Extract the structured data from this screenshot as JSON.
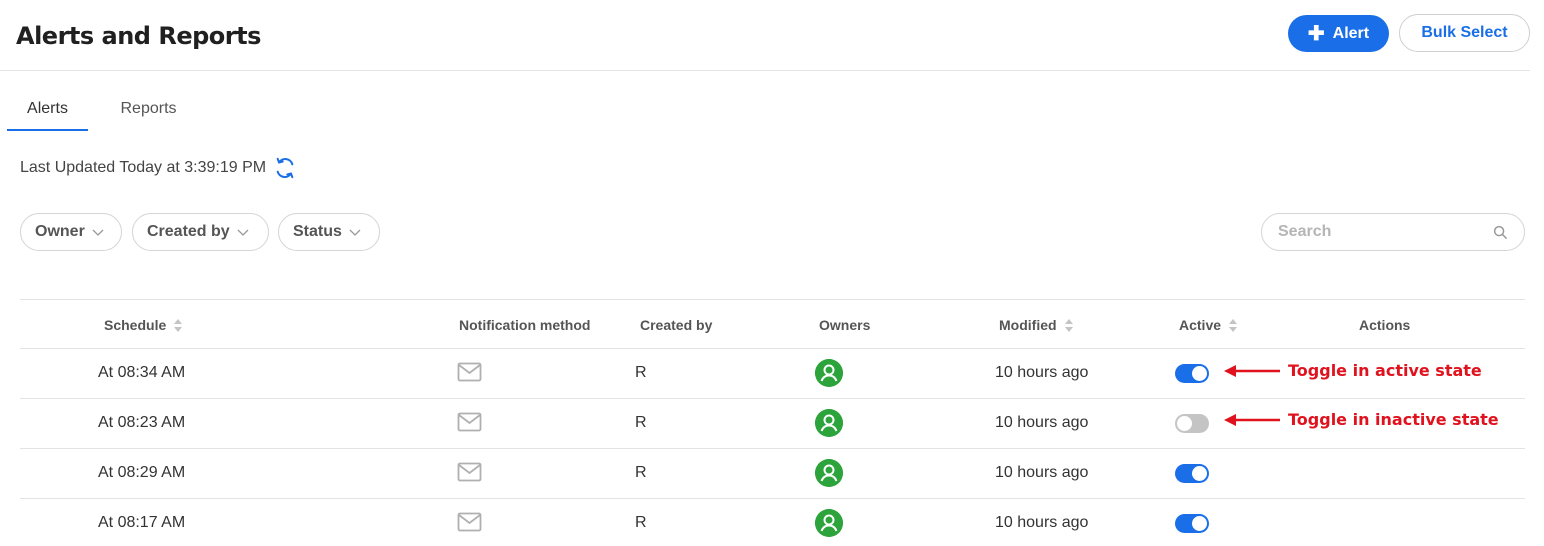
{
  "header": {
    "title": "Alerts and Reports",
    "add_alert_label": "Alert",
    "bulk_select_label": "Bulk Select"
  },
  "tabs": [
    {
      "label": "Alerts",
      "active": true
    },
    {
      "label": "Reports",
      "active": false
    }
  ],
  "last_updated": "Last Updated Today at 3:39:19 PM",
  "filters": [
    {
      "label": "Owner"
    },
    {
      "label": "Created by"
    },
    {
      "label": "Status"
    }
  ],
  "search": {
    "placeholder": "Search",
    "value": ""
  },
  "table": {
    "columns": [
      "Schedule",
      "Notification method",
      "Created by",
      "Owners",
      "Modified",
      "Active",
      "Actions"
    ],
    "rows": [
      {
        "schedule": "At 08:34 AM",
        "notification": "mail-icon",
        "created_by": "R",
        "owner": "user-avatar",
        "modified": "10 hours ago",
        "active": true
      },
      {
        "schedule": "At 08:23 AM",
        "notification": "mail-icon",
        "created_by": "R",
        "owner": "user-avatar",
        "modified": "10 hours ago",
        "active": false
      },
      {
        "schedule": "At 08:29 AM",
        "notification": "mail-icon",
        "created_by": "R",
        "owner": "user-avatar",
        "modified": "10 hours ago",
        "active": true
      },
      {
        "schedule": "At 08:17 AM",
        "notification": "mail-icon",
        "created_by": "R",
        "owner": "user-avatar",
        "modified": "10 hours ago",
        "active": true
      }
    ]
  },
  "annotations": {
    "active": "Toggle in active state",
    "inactive": "Toggle in inactive state"
  },
  "colors": {
    "accent": "#1a6fe8",
    "avatar": "#2ca33b",
    "annotation": "#e0121d",
    "toggle_off": "#c4c4c4"
  }
}
